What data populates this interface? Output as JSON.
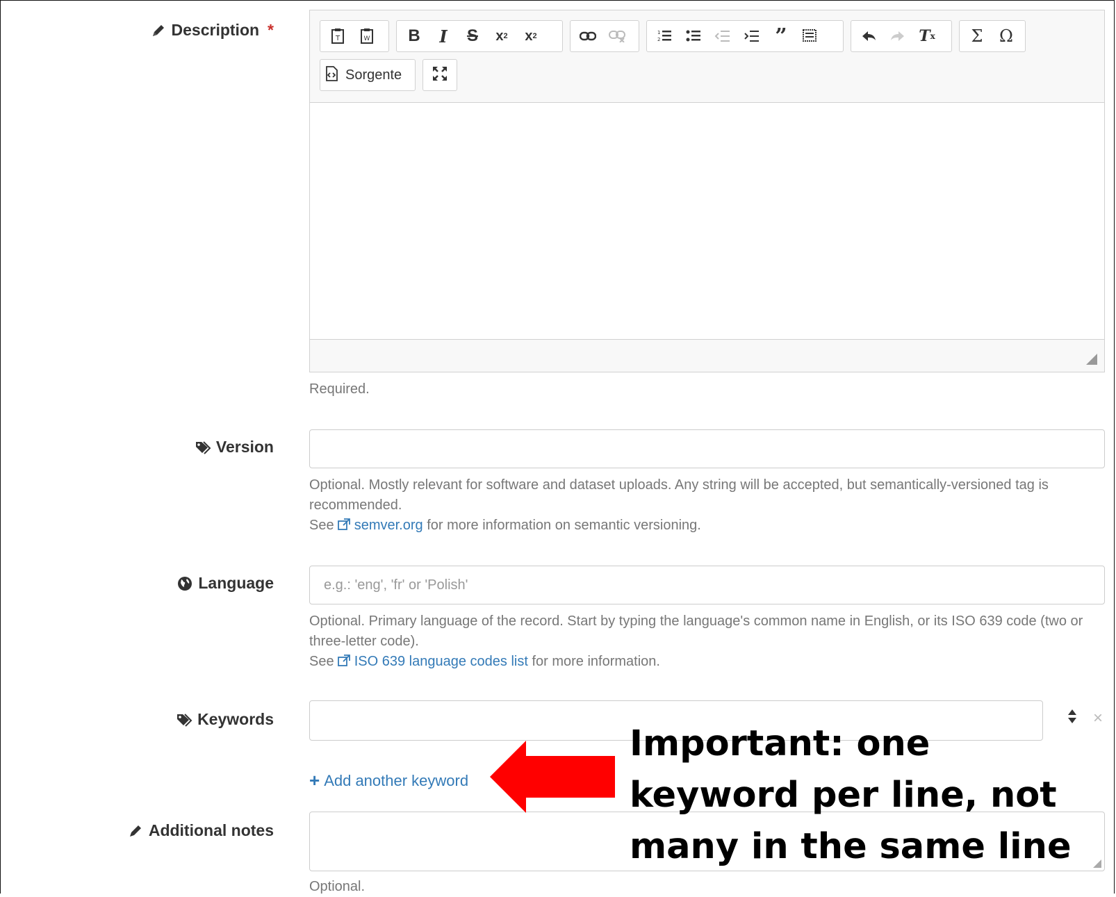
{
  "description": {
    "label": "Description",
    "required_marker": "*",
    "help": "Required.",
    "toolbar": {
      "source_label": "Sorgente"
    }
  },
  "version": {
    "label": "Version",
    "value": "",
    "help_line1": "Optional. Mostly relevant for software and dataset uploads. Any string will be accepted, but semantically-versioned tag is recommended.",
    "help_see": "See",
    "help_link": "semver.org",
    "help_rest": "for more information on semantic versioning."
  },
  "language": {
    "label": "Language",
    "placeholder": "e.g.: 'eng', 'fr' or 'Polish'",
    "help_line1": "Optional. Primary language of the record. Start by typing the language's common name in English, or its ISO 639 code (two or three-letter code).",
    "help_see": "See",
    "help_link": "ISO 639 language codes list",
    "help_rest": "for more information."
  },
  "keywords": {
    "label": "Keywords",
    "value": "",
    "add_label": "Add another keyword",
    "remove_symbol": "×"
  },
  "additional_notes": {
    "label": "Additional notes",
    "value": "",
    "help": "Optional."
  },
  "annotation": {
    "text": "Important: one keyword per line, not many in the same line",
    "arrow_color": "#ff0000"
  },
  "colors": {
    "link": "#337ab7",
    "required": "#c9302c",
    "help_text": "#777777"
  }
}
